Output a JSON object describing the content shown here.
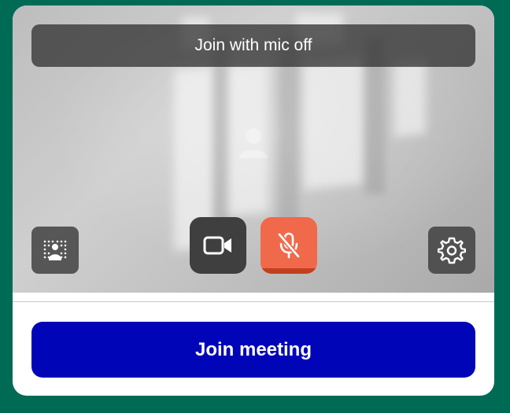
{
  "preview": {
    "mic_status_text": "Join with mic off"
  },
  "controls": {
    "background_effects_icon": "background-effects-icon",
    "camera_icon": "video-camera-icon",
    "camera_state": "on",
    "mic_icon": "microphone-off-icon",
    "mic_state": "off",
    "settings_icon": "gear-icon"
  },
  "actions": {
    "join_label": "Join meeting"
  },
  "colors": {
    "page_background": "#006b55",
    "join_button": "#0005b8",
    "mic_off_button": "#f0694a",
    "camera_button": "#3f3f3f"
  }
}
